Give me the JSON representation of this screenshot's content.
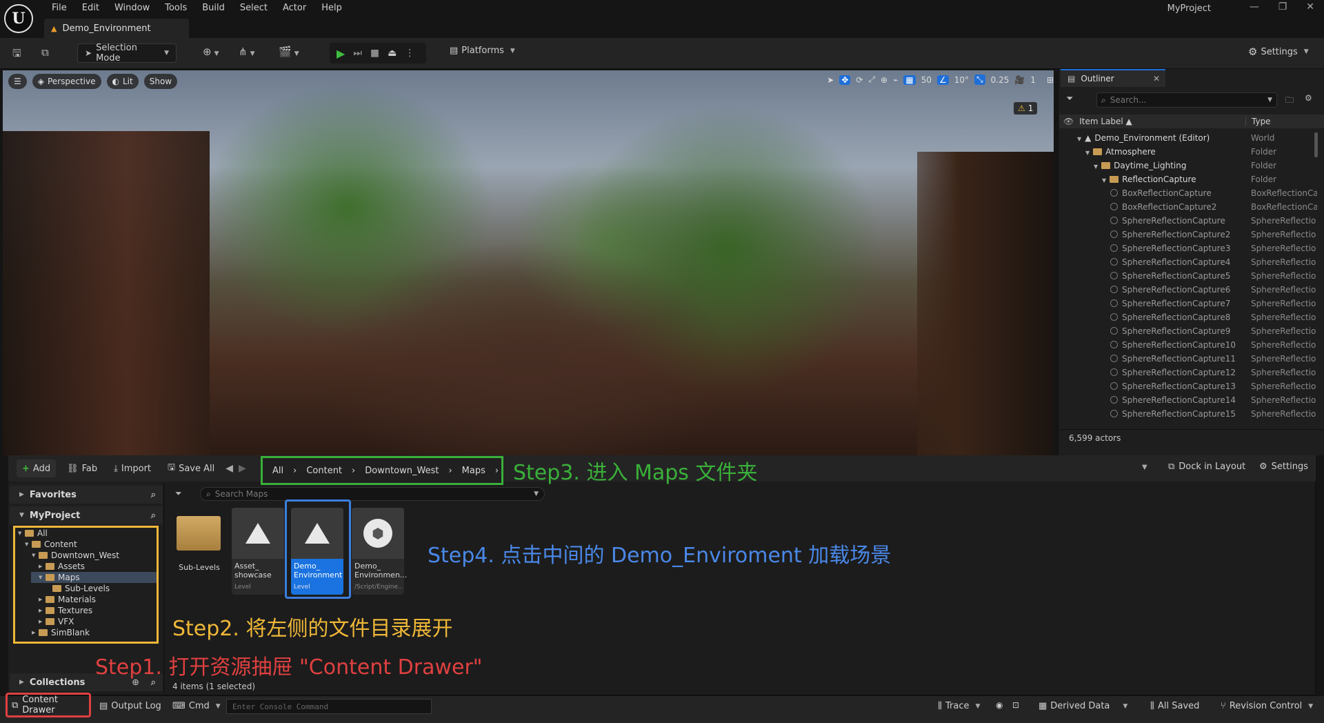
{
  "app": {
    "logo": "U",
    "menus": [
      "File",
      "Edit",
      "Window",
      "Tools",
      "Build",
      "Select",
      "Actor",
      "Help"
    ],
    "document_tab": "Demo_Environment",
    "project_name": "MyProject",
    "window_controls": [
      "—",
      "❐",
      "✕"
    ]
  },
  "toolbar": {
    "selection_mode": "Selection Mode",
    "platforms": "Platforms",
    "settings": "Settings"
  },
  "viewport": {
    "menu_icon": "☰",
    "perspective": "Perspective",
    "lit": "Lit",
    "show": "Show",
    "grid_snap": "50",
    "rotation_snap": "10°",
    "scale_snap": "0.25",
    "camera_speed": "1",
    "warning_count": "1"
  },
  "outliner": {
    "tab_title": "Outliner",
    "search_placeholder": "Search...",
    "col_label": "Item Label ▲",
    "col_type": "Type",
    "actor_count": "6,599 actors",
    "rows": [
      {
        "label": "Demo_Environment (Editor)",
        "type": "World",
        "depth": 0,
        "kind": "world"
      },
      {
        "label": "Atmosphere",
        "type": "Folder",
        "depth": 1,
        "kind": "folder"
      },
      {
        "label": "Daytime_Lighting",
        "type": "Folder",
        "depth": 2,
        "kind": "folder"
      },
      {
        "label": "ReflectionCapture",
        "type": "Folder",
        "depth": 3,
        "kind": "folder"
      },
      {
        "label": "BoxReflectionCapture",
        "type": "BoxReflectionCa",
        "depth": 4,
        "kind": "actor"
      },
      {
        "label": "BoxReflectionCapture2",
        "type": "BoxReflectionCa",
        "depth": 4,
        "kind": "actor"
      },
      {
        "label": "SphereReflectionCapture",
        "type": "SphereReflectio",
        "depth": 4,
        "kind": "actor"
      },
      {
        "label": "SphereReflectionCapture2",
        "type": "SphereReflectio",
        "depth": 4,
        "kind": "actor"
      },
      {
        "label": "SphereReflectionCapture3",
        "type": "SphereReflectio",
        "depth": 4,
        "kind": "actor"
      },
      {
        "label": "SphereReflectionCapture4",
        "type": "SphereReflectio",
        "depth": 4,
        "kind": "actor"
      },
      {
        "label": "SphereReflectionCapture5",
        "type": "SphereReflectio",
        "depth": 4,
        "kind": "actor"
      },
      {
        "label": "SphereReflectionCapture6",
        "type": "SphereReflectio",
        "depth": 4,
        "kind": "actor"
      },
      {
        "label": "SphereReflectionCapture7",
        "type": "SphereReflectio",
        "depth": 4,
        "kind": "actor"
      },
      {
        "label": "SphereReflectionCapture8",
        "type": "SphereReflectio",
        "depth": 4,
        "kind": "actor"
      },
      {
        "label": "SphereReflectionCapture9",
        "type": "SphereReflectio",
        "depth": 4,
        "kind": "actor"
      },
      {
        "label": "SphereReflectionCapture10",
        "type": "SphereReflectio",
        "depth": 4,
        "kind": "actor"
      },
      {
        "label": "SphereReflectionCapture11",
        "type": "SphereReflectio",
        "depth": 4,
        "kind": "actor"
      },
      {
        "label": "SphereReflectionCapture12",
        "type": "SphereReflectio",
        "depth": 4,
        "kind": "actor"
      },
      {
        "label": "SphereReflectionCapture13",
        "type": "SphereReflectio",
        "depth": 4,
        "kind": "actor"
      },
      {
        "label": "SphereReflectionCapture14",
        "type": "SphereReflectio",
        "depth": 4,
        "kind": "actor"
      },
      {
        "label": "SphereReflectionCapture15",
        "type": "SphereReflectio",
        "depth": 4,
        "kind": "actor"
      }
    ]
  },
  "drawer": {
    "add": "Add",
    "fab": "Fab",
    "import": "Import",
    "save_all": "Save All",
    "breadcrumbs": [
      "All",
      "Content",
      "Downtown_West",
      "Maps"
    ],
    "dock_in_layout": "Dock in Layout",
    "settings": "Settings",
    "favorites": "Favorites",
    "project": "MyProject",
    "collections": "Collections",
    "search_placeholder": "Search Maps",
    "items_count": "4 items (1 selected)",
    "tree": [
      {
        "label": "All",
        "depth": 0,
        "open": true
      },
      {
        "label": "Content",
        "depth": 1,
        "open": true
      },
      {
        "label": "Downtown_West",
        "depth": 2,
        "open": true
      },
      {
        "label": "Assets",
        "depth": 3,
        "open": false
      },
      {
        "label": "Maps",
        "depth": 3,
        "open": true
      },
      {
        "label": "Sub-Levels",
        "depth": 4,
        "open": false
      },
      {
        "label": "Materials",
        "depth": 3,
        "open": false
      },
      {
        "label": "Textures",
        "depth": 3,
        "open": false
      },
      {
        "label": "VFX",
        "depth": 3,
        "open": false
      },
      {
        "label": "SimBlank",
        "depth": 2,
        "open": false
      }
    ],
    "tiles": [
      {
        "name": "Sub-Levels",
        "sub": "",
        "kind": "folder"
      },
      {
        "name": "Asset_ showcase",
        "sub": "Level",
        "kind": "level"
      },
      {
        "name": "Demo_ Environment",
        "sub": "Level",
        "kind": "level-selected"
      },
      {
        "name": "Demo_ Environmen...",
        "sub": "/Script/Engine...",
        "kind": "sphere"
      }
    ]
  },
  "annotations": {
    "step1": "Step1. 打开资源抽屉 \"Content Drawer\"",
    "step2": "Step2. 将左侧的文件目录展开",
    "step3": "Step3. 进入 Maps 文件夹",
    "step4": "Step4. 点击中间的 Demo_Enviroment 加载场景",
    "colors": {
      "step1": "#e04040",
      "step2": "#f0b838",
      "step3": "#3ab03a",
      "step4": "#4a88e8"
    }
  },
  "statusbar": {
    "content_drawer": "Content Drawer",
    "output_log": "Output Log",
    "cmd": "Cmd",
    "console_placeholder": "Enter Console Command",
    "trace": "Trace",
    "derived_data": "Derived Data",
    "all_saved": "All Saved",
    "revision_control": "Revision Control"
  }
}
